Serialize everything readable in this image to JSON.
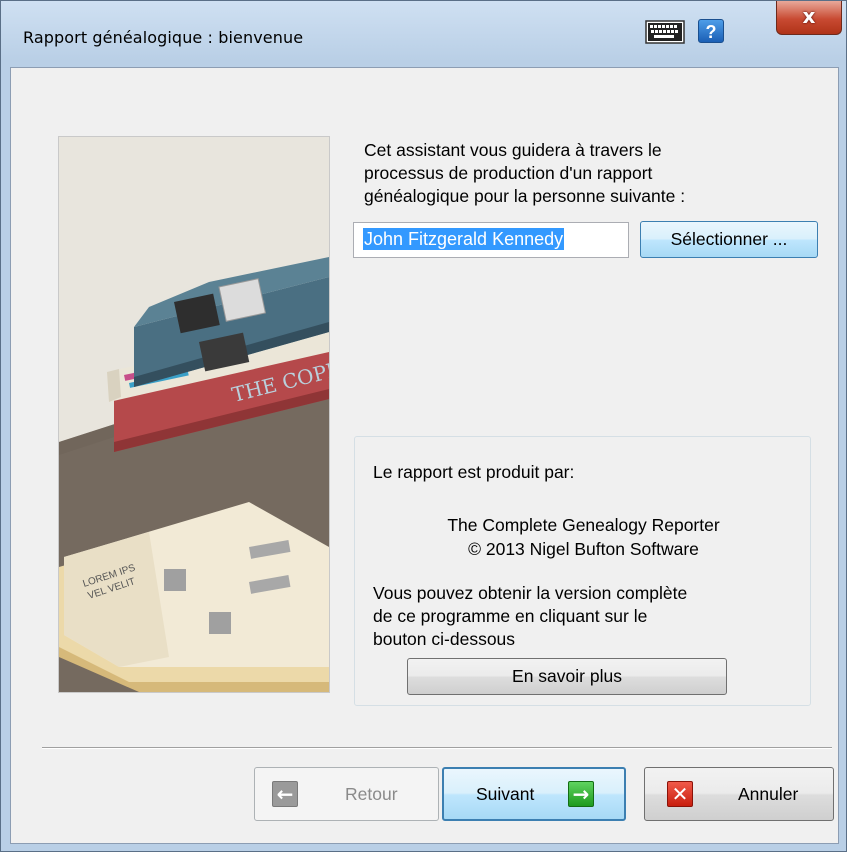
{
  "window": {
    "title": "Rapport généalogique : bienvenue",
    "help_label": "?",
    "close_label": "x"
  },
  "intro": {
    "lines": [
      "Cet assistant vous guidera à travers le",
      "processus de production d'un rapport",
      "généalogique pour la personne suivante :"
    ],
    "person_value": "John Fitzgerald Kennedy",
    "select_button": "Sélectionner ..."
  },
  "illustration": {
    "book_spine_text": "THE COPP",
    "paper_text_1": "LOREM IPS",
    "paper_text_2": "VEL VELIT"
  },
  "info": {
    "lead": "Le rapport est produit par:",
    "product_name": "The Complete Genealogy Reporter",
    "copyright": "© 2013 Nigel Bufton Software",
    "body_lines": [
      "Vous pouvez obtenir la version complète",
      "de ce programme en cliquant sur le",
      "bouton ci-dessous"
    ],
    "more_button": "En savoir plus"
  },
  "footer": {
    "back_label": "Retour",
    "next_label": "Suivant",
    "cancel_label": "Annuler",
    "back_icon": "arrow-left-icon",
    "next_icon": "arrow-right-icon",
    "cancel_icon": "close-icon"
  },
  "colors": {
    "selection": "#3399ff",
    "next_icon": "#1e9a1e",
    "cancel_icon": "#c81e0e",
    "book_blue": "#4a6f82",
    "book_red": "#b5494b"
  }
}
